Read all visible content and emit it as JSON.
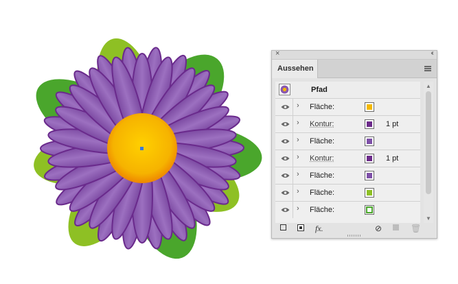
{
  "panel": {
    "title": "Aussehen",
    "target": "Pfad",
    "rows": [
      {
        "label": "Fläche:",
        "stroke": "",
        "color": "#f5b800",
        "kind": "fill"
      },
      {
        "label": "Kontur:",
        "stroke": "1 pt",
        "color": "#6c2a8a",
        "kind": "fill"
      },
      {
        "label": "Fläche:",
        "stroke": "",
        "color": "#7e50a8",
        "kind": "fill"
      },
      {
        "label": "Kontur:",
        "stroke": "1 pt",
        "color": "#6c2a8a",
        "kind": "fill"
      },
      {
        "label": "Fläche:",
        "stroke": "",
        "color": "#7e50a8",
        "kind": "fill"
      },
      {
        "label": "Fläche:",
        "stroke": "",
        "color": "#8ec024",
        "kind": "fill"
      },
      {
        "label": "Fläche:",
        "stroke": "",
        "color": "#4aa62c",
        "kind": "ring"
      }
    ],
    "icons": [
      "close-icon",
      "collapse-icon",
      "panel-menu-icon",
      "eye-icon",
      "chevron-right-icon",
      "new-stroke-icon",
      "new-fill-icon",
      "fx-icon",
      "clear-icon",
      "duplicate-icon",
      "delete-icon"
    ],
    "fx_label": "fx."
  },
  "artwork": {
    "petal_purple": "#8a5aae",
    "petal_outline": "#6a2a8c",
    "leaf_light": "#8ec024",
    "leaf_dark": "#4aa62c",
    "center_color": "#f7b500",
    "center_edge": "#f08a00"
  }
}
